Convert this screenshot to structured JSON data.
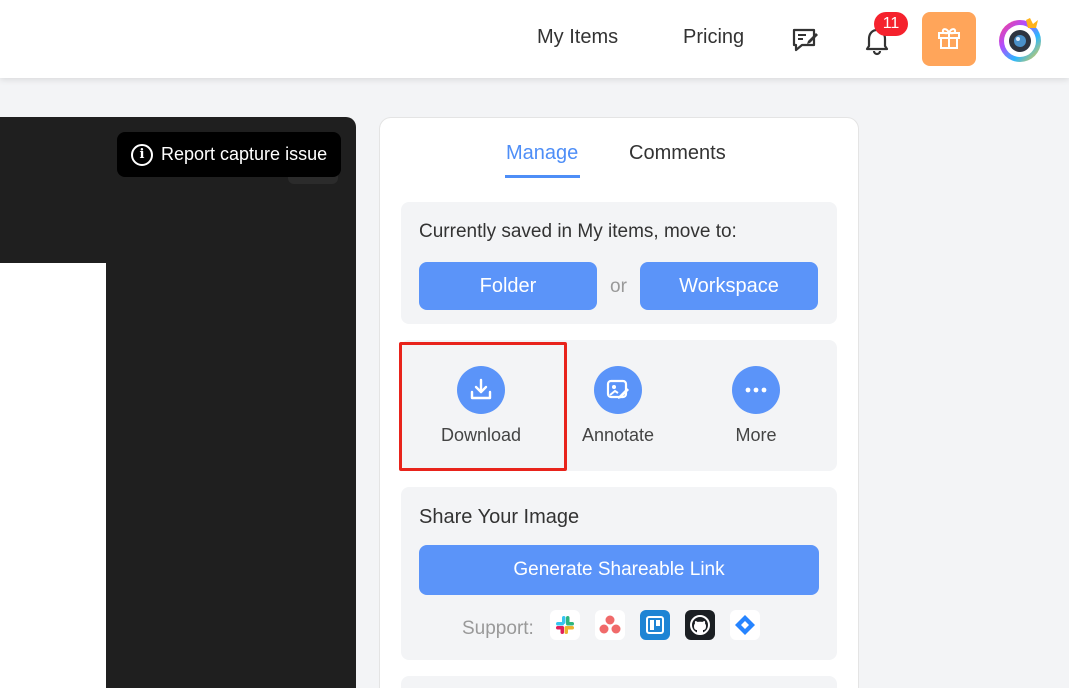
{
  "header": {
    "nav": [
      {
        "label": "My Items"
      },
      {
        "label": "Pricing"
      }
    ],
    "notifications": {
      "count": "11"
    },
    "icons": {
      "feedback": "feedback-edit-icon",
      "bell": "bell-icon",
      "gift": "gift-icon",
      "avatar": "camera-avatar-icon"
    },
    "colors": {
      "gift_bg": "#ffa55a",
      "badge": "#f5222d"
    }
  },
  "preview": {
    "report_button": "Report capture issue"
  },
  "panel": {
    "tabs": [
      {
        "label": "Manage",
        "active": true
      },
      {
        "label": "Comments",
        "active": false
      }
    ],
    "move": {
      "title": "Currently saved in My items, move to:",
      "folder_label": "Folder",
      "or_label": "or",
      "workspace_label": "Workspace"
    },
    "actions": [
      {
        "label": "Download",
        "icon": "download-icon"
      },
      {
        "label": "Annotate",
        "icon": "annotate-icon"
      },
      {
        "label": "More",
        "icon": "more-dots-icon"
      }
    ],
    "share": {
      "title": "Share Your Image",
      "button_label": "Generate Shareable Link",
      "support_label": "Support:",
      "integrations": [
        "Slack",
        "Asana",
        "Trello",
        "GitHub",
        "Jira"
      ]
    }
  },
  "colors": {
    "accent": "#5b94f9",
    "active_tab": "#4e8ef7",
    "highlight": "#e8231b"
  }
}
